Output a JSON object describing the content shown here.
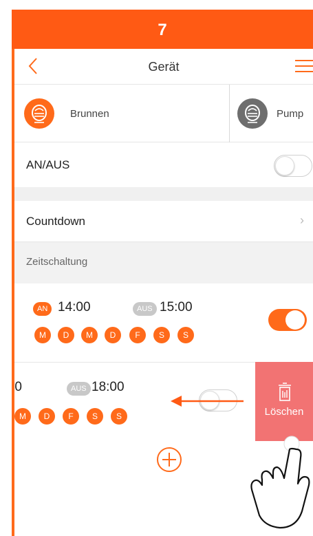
{
  "step": {
    "number": "7"
  },
  "nav": {
    "title": "Gerät",
    "back_icon": "chevron-left-icon",
    "menu_icon": "hamburger-menu-icon"
  },
  "devices": [
    {
      "name": "Brunnen",
      "icon": "fountain-device-icon",
      "color": "#ff6a1a"
    },
    {
      "name": "Pump",
      "icon": "pump-device-icon",
      "color": "#6e6e6e"
    }
  ],
  "power": {
    "label": "AN/AUS",
    "on": false
  },
  "countdown": {
    "label": "Countdown",
    "chevron": "›"
  },
  "timer_section": {
    "label": "Zeitschaltung"
  },
  "schedules": [
    {
      "on_badge": "AN",
      "on_time": "14:00",
      "off_badge": "AUS",
      "off_time": "15:00",
      "days": [
        "M",
        "D",
        "M",
        "D",
        "F",
        "S",
        "S"
      ],
      "enabled": true
    },
    {
      "on_time_partial": ")0",
      "off_badge": "AUS",
      "off_time": "18:00",
      "days": [
        "M",
        "D",
        "F",
        "S",
        "S"
      ],
      "enabled": false,
      "delete_label": "Löschen",
      "delete_icon": "trash-icon"
    }
  ],
  "add_icon": "add-circle-icon",
  "gesture": {
    "icon": "pointing-hand-icon",
    "swipe_direction": "left"
  },
  "colors": {
    "accent": "#ff5a14",
    "delete": "#f27373",
    "inactive": "#c8c8c8"
  }
}
